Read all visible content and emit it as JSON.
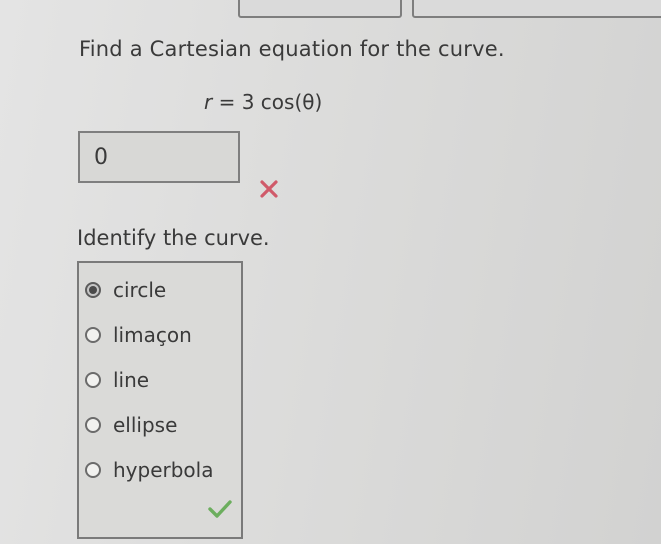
{
  "question": {
    "prompt": "Find a Cartesian equation for the curve.",
    "equation_var": "r",
    "equation_rest": " = 3 cos(θ)"
  },
  "answer": {
    "value": "0",
    "status_icon": "x-mark-icon",
    "status_color": "#d05a6a"
  },
  "identify": {
    "prompt": "Identify the curve.",
    "options": [
      {
        "label": "circle",
        "selected": true
      },
      {
        "label": "limaçon",
        "selected": false
      },
      {
        "label": "line",
        "selected": false
      },
      {
        "label": "ellipse",
        "selected": false
      },
      {
        "label": "hyperbola",
        "selected": false
      }
    ],
    "status_icon": "checkmark-icon",
    "status_color": "#6cae5e"
  }
}
